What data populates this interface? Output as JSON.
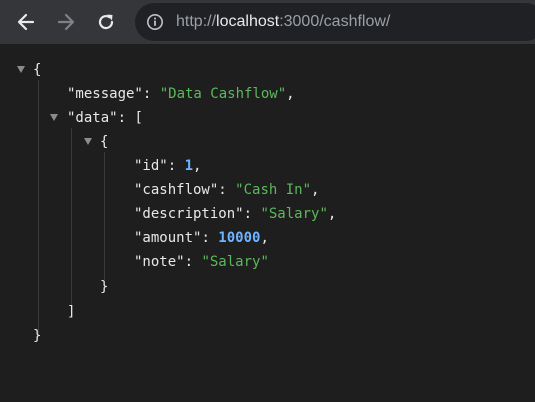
{
  "browser": {
    "url_scheme": "http://",
    "url_host": "localhost",
    "url_rest": ":3000/cashflow/",
    "icons": {
      "back": "arrow-left-icon",
      "forward": "arrow-right-icon",
      "reload": "reload-icon",
      "site_info": "info-circle-icon"
    }
  },
  "json": {
    "open_brace": "{",
    "close_brace": "}",
    "message_key": "\"message\"",
    "message_value": "\"Data Cashflow\"",
    "data_key": "\"data\"",
    "data_open": "[",
    "data_close": "]",
    "item_open": "{",
    "item_close": "}",
    "id_key": "\"id\"",
    "id_value": "1",
    "cashflow_key": "\"cashflow\"",
    "cashflow_value": "\"Cash In\"",
    "description_key": "\"description\"",
    "description_value": "\"Salary\"",
    "amount_key": "\"amount\"",
    "amount_value": "10000",
    "note_key": "\"note\"",
    "note_value": "\"Salary\"",
    "colon": ": ",
    "comma": ","
  },
  "colors": {
    "string": "#5cb85c",
    "number": "#6cb5ff",
    "text": "#e8e8e8",
    "background": "#1e1e1e"
  }
}
